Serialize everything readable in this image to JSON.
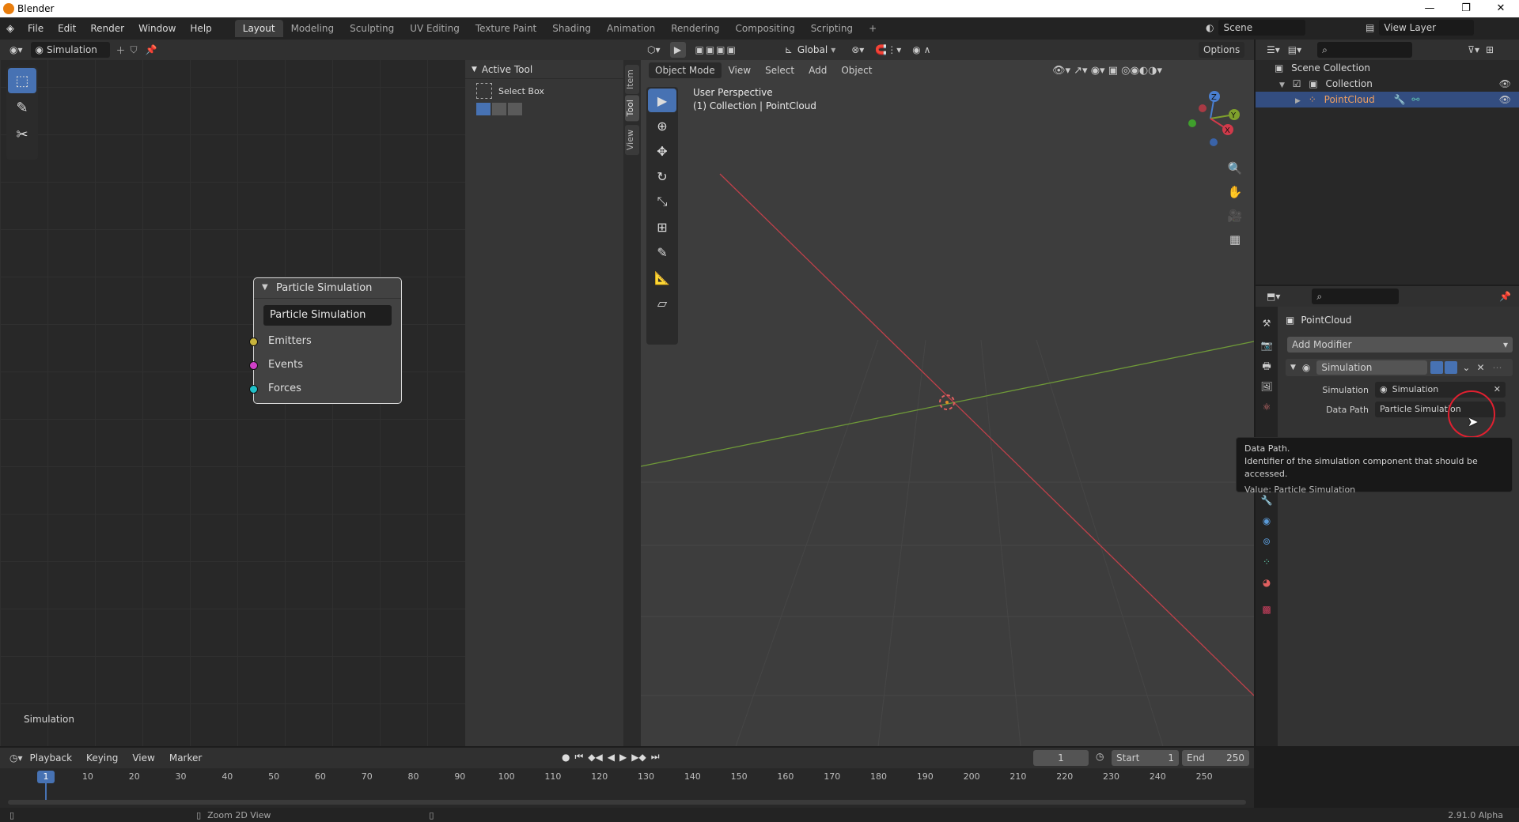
{
  "window": {
    "title": "Blender",
    "minimize": "—",
    "maximize": "❐",
    "close": "✕"
  },
  "menu": [
    "File",
    "Edit",
    "Render",
    "Window",
    "Help"
  ],
  "workspaces": [
    "Layout",
    "Modeling",
    "Sculpting",
    "UV Editing",
    "Texture Paint",
    "Shading",
    "Animation",
    "Rendering",
    "Compositing",
    "Scripting"
  ],
  "workspace_add": "+",
  "scene": {
    "label": "Scene",
    "view_layer": "View Layer"
  },
  "node_editor": {
    "datablock": "Simulation",
    "node": {
      "title": "Particle Simulation",
      "name_field": "Particle Simulation",
      "sockets": [
        {
          "label": "Emitters",
          "color": "#c8b43c"
        },
        {
          "label": "Events",
          "color": "#d040c8"
        },
        {
          "label": "Forces",
          "color": "#20c0c8"
        }
      ]
    },
    "footer_label": "Simulation",
    "sidebar": {
      "panel": "Active Tool",
      "tool_name": "Select Box",
      "tabs": [
        "Item",
        "Tool",
        "View"
      ]
    }
  },
  "viewport": {
    "mode": "Object Mode",
    "menus": [
      "View",
      "Select",
      "Add",
      "Object"
    ],
    "orientation": "Global",
    "options": "Options",
    "overlay_title": "User Perspective",
    "overlay_sub": "(1) Collection | PointCloud",
    "gizmo": {
      "x": "X",
      "y": "Y",
      "z": "Z"
    }
  },
  "outliner": {
    "rows": [
      {
        "label": "Scene Collection"
      },
      {
        "label": "Collection"
      },
      {
        "label": "PointCloud"
      }
    ]
  },
  "properties": {
    "object": "PointCloud",
    "add_modifier": "Add Modifier",
    "modifier_name": "Simulation",
    "fields": [
      {
        "label": "Simulation",
        "value": "Simulation"
      },
      {
        "label": "Data Path",
        "value": "Particle Simulation"
      }
    ]
  },
  "tooltip": {
    "title": "Data Path.",
    "desc": "Identifier of the simulation component that should be accessed.",
    "value": "Value: Particle Simulation"
  },
  "timeline": {
    "menus": [
      "Playback",
      "Keying",
      "View",
      "Marker"
    ],
    "current_frame": "1",
    "start_label": "Start",
    "start": "1",
    "end_label": "End",
    "end": "250",
    "ticks": [
      "1",
      "10",
      "20",
      "30",
      "40",
      "50",
      "60",
      "70",
      "80",
      "90",
      "100",
      "110",
      "120",
      "130",
      "140",
      "150",
      "160",
      "170",
      "180",
      "190",
      "200",
      "210",
      "220",
      "230",
      "240",
      "250"
    ]
  },
  "status": {
    "hint": "Zoom 2D View",
    "version": "2.91.0 Alpha"
  }
}
